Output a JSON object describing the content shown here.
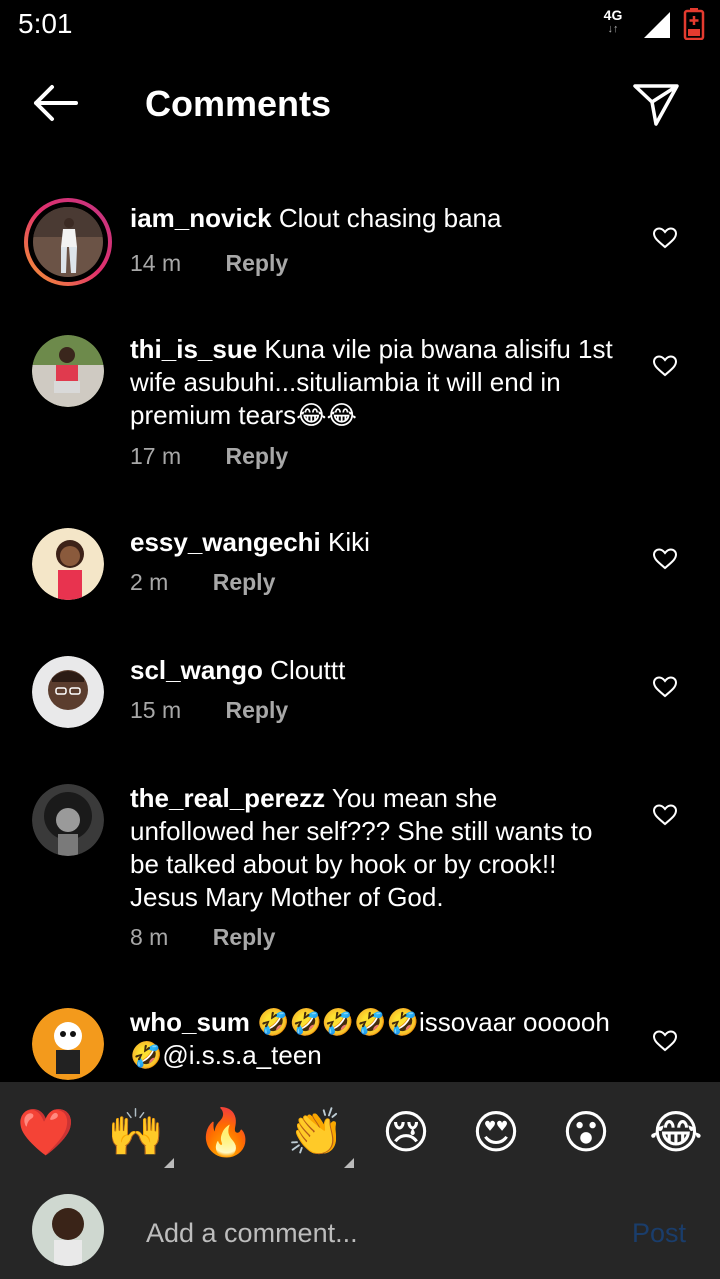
{
  "status_bar": {
    "time": "5:01",
    "network": "4G"
  },
  "header": {
    "title": "Comments"
  },
  "comments": [
    {
      "username": "iam_novick",
      "text": "Clout chasing bana",
      "age": "14 m",
      "reply_label": "Reply"
    },
    {
      "username": "thi_is_sue",
      "text": "Kuna vile pia bwana alisifu 1st wife asubuhi...situliambia it will end in premium tears😂😂",
      "age": "17 m",
      "reply_label": "Reply"
    },
    {
      "username": "essy_wangechi",
      "text": "Kiki",
      "age": "2 m",
      "reply_label": "Reply"
    },
    {
      "username": "scl_wango",
      "text": "Clouttt",
      "age": "15 m",
      "reply_label": "Reply"
    },
    {
      "username": "the_real_perezz",
      "text": "You mean she unfollowed her self??? She still wants to be talked about by hook or by crook!! Jesus Mary Mother of God.",
      "age": "8 m",
      "reply_label": "Reply"
    },
    {
      "username": "who_sum",
      "text": "🤣🤣🤣🤣🤣issovaar oooooh🤣@i.s.s.a_teen",
      "age": "",
      "reply_label": ""
    }
  ],
  "reactions": [
    "❤️",
    "🙌",
    "🔥",
    "👏",
    "😢",
    "😍",
    "😮",
    "😂"
  ],
  "composer": {
    "placeholder": "Add a comment...",
    "post_label": "Post"
  },
  "colors": {
    "background": "#000000",
    "bar": "#262626",
    "muted_text": "#a8a8a8",
    "post_disabled": "#1a3d6b"
  }
}
